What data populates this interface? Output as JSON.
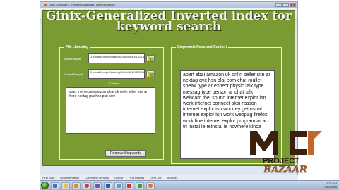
{
  "ide": {
    "title": "Ginix (Desktop) - [Project Suraj Babu Generalization]",
    "menu": [
      "File",
      "Edit",
      "View",
      "Project",
      "Build",
      "Debug",
      "Tools",
      "Test",
      "Window",
      "Help"
    ],
    "tab": "Ginix",
    "status_items": [
      "Find Start",
      "Documentation",
      "Command Window",
      "Output",
      "Find Results",
      "Error List",
      "Browser"
    ]
  },
  "frame": {
    "title": "Ginix-Generalized Inverted index for keyword search"
  },
  "file_panel": {
    "legend": "File choosing",
    "input_label": "Input Filepath",
    "input_path": "D:\\ronald\\project\\babu\\g\\Ginix\\GINIX\\DSS.1\\GenericData\\TextDoc",
    "output_label": "Output Filepath",
    "output_path": "D:\\ronald\\project\\babu\\g\\Ginix\\GINIX\\DSS.1\\GenericData\\Output\\lyric",
    "content_label": "Content",
    "content_text": "apart from ebai amazon what uk onlin seller site ar there nextag gvc hsn plai com",
    "remove_button": "Remove Stopwords"
  },
  "result_panel": {
    "legend": "Stopwords Removed Content",
    "text": "apart ebai amazon uk onlin seller site ar nextag qvc hsn plai com chat roullet speak type ar expect physic talk type messag type person ar chat talk webcam thei sound  internet explor isn work internet connect okai reason internet explor isn work ey get usual internet explor isn work webpag firefox work fine internet explor program ar act tri instal ie reinstal ie nowhere kinda"
  },
  "logo": {
    "letters": "MC",
    "line1": "PROJECT",
    "line2": "BAZAAR"
  },
  "taskbar": {
    "time": "1:24 PM",
    "date": "1/12/2014"
  },
  "colors": {
    "frame_bg": "#7a9a33",
    "logo_dark": "#3b1f0f",
    "logo_accent": "#c2662a"
  }
}
